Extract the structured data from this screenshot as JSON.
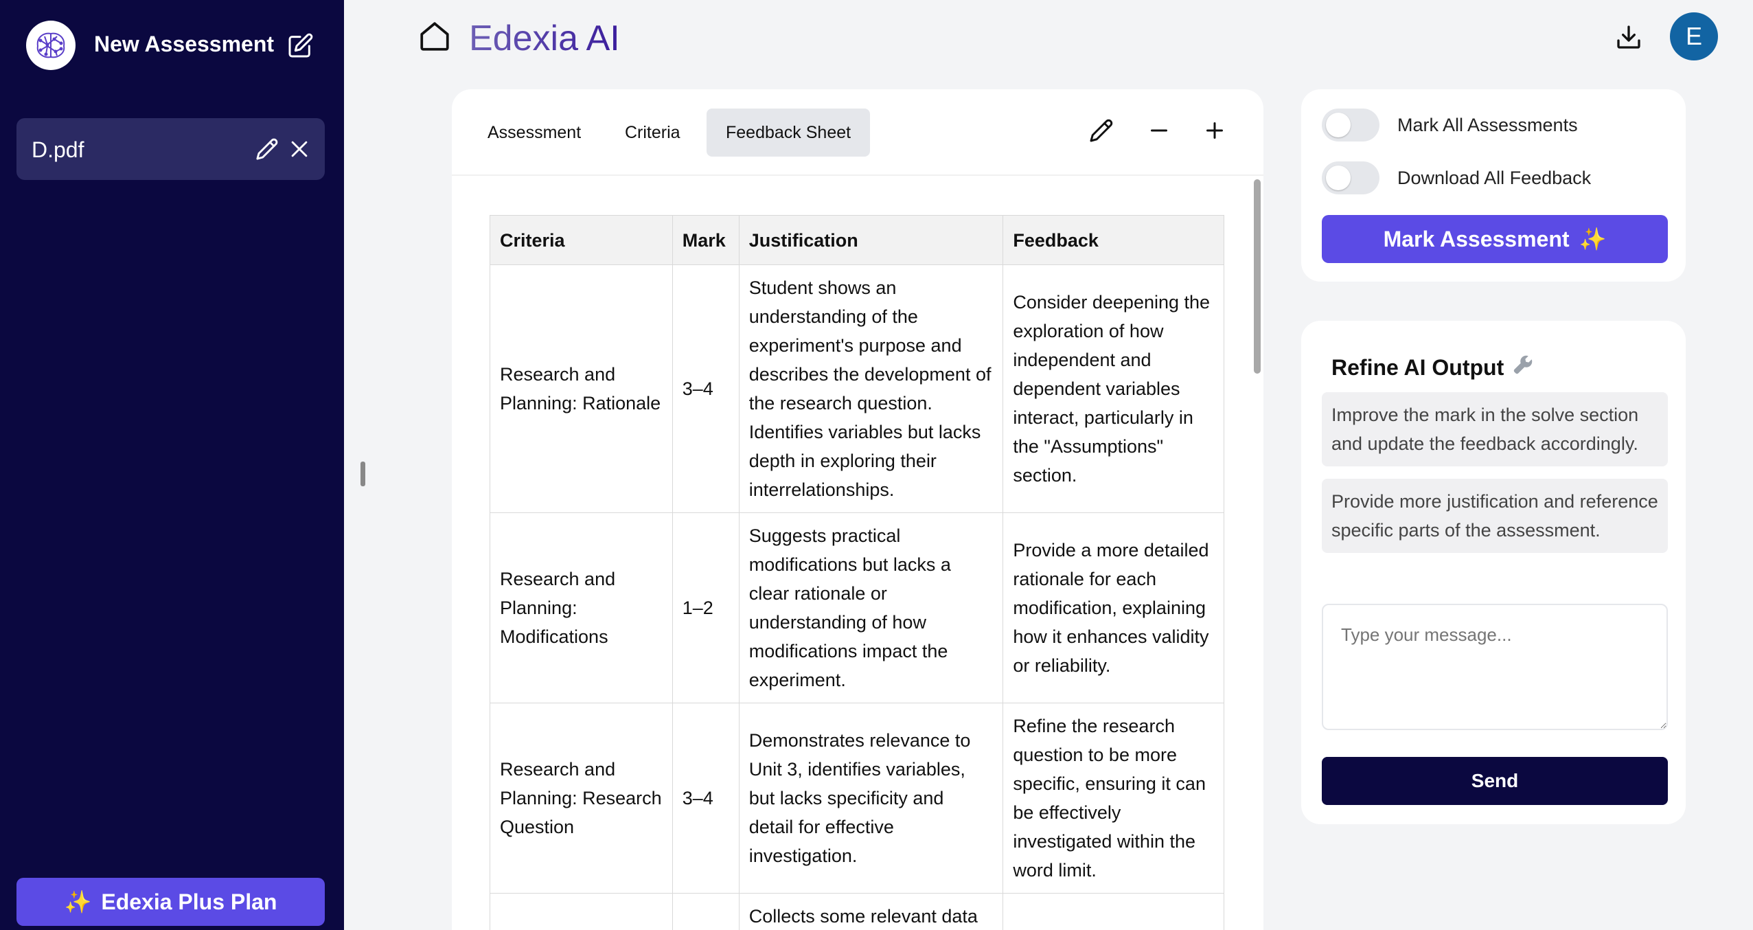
{
  "sidebar": {
    "new_assessment_label": "New Assessment",
    "file": {
      "name": "D.pdf"
    },
    "plan_button": {
      "icon": "✨",
      "label": "Edexia Plus Plan"
    }
  },
  "header": {
    "brand": "Edexia AI",
    "avatar_initial": "E"
  },
  "tabs": [
    {
      "label": "Assessment",
      "active": false
    },
    {
      "label": "Criteria",
      "active": false
    },
    {
      "label": "Feedback Sheet",
      "active": true
    }
  ],
  "table": {
    "headers": [
      "Criteria",
      "Mark",
      "Justification",
      "Feedback"
    ],
    "rows": [
      {
        "criteria": "Research and Planning: Rationale",
        "mark": "3–4",
        "justification": "Student shows an understanding of the experiment's purpose and describes the development of the research question. Identifies variables but lacks depth in exploring their interrelationships.",
        "feedback": "Consider deepening the exploration of how independent and dependent variables interact, particularly in the \"Assumptions\" section."
      },
      {
        "criteria": "Research and Planning: Modifications",
        "mark": "1–2",
        "justification": "Suggests practical modifications but lacks a clear rationale or understanding of how modifications impact the experiment.",
        "feedback": "Provide a more detailed rationale for each modification, explaining how it enhances validity or reliability."
      },
      {
        "criteria": "Research and Planning: Research Question",
        "mark": "3–4",
        "justification": "Demonstrates relevance to Unit 3, identifies variables, but lacks specificity and detail for effective investigation.",
        "feedback": "Refine the research question to be more specific, ensuring it can be effectively investigated within the word limit."
      },
      {
        "criteria": "",
        "mark": "",
        "justification": "Collects some relevant data",
        "feedback": ""
      }
    ]
  },
  "options": {
    "mark_all_label": "Mark All Assessments",
    "mark_all_on": false,
    "download_all_label": "Download All Feedback",
    "download_all_on": false,
    "mark_button": {
      "label": "Mark Assessment",
      "icon": "✨"
    }
  },
  "refine": {
    "title": "Refine AI Output",
    "suggestions": [
      "Improve the mark in the solve section and update the feedback accordingly.",
      "Provide more justification and reference specific parts of the assessment."
    ],
    "placeholder": "Type your message...",
    "send_label": "Send"
  },
  "colors": {
    "sidebar": "#0b0840",
    "accent": "#5b4be5",
    "avatar": "#1264a3"
  }
}
